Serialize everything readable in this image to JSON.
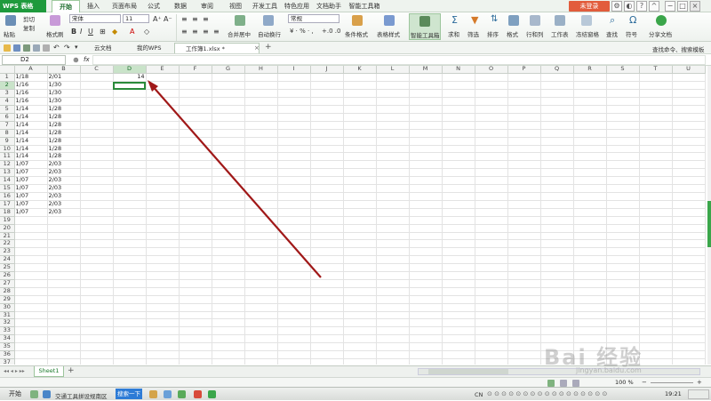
{
  "app": {
    "logo_label": "WPS 表格",
    "login_label": "未登录"
  },
  "menu": {
    "tabs": [
      {
        "label": "开始",
        "active": true
      },
      {
        "label": "插入"
      },
      {
        "label": "页面布局"
      },
      {
        "label": "公式"
      },
      {
        "label": "数据"
      },
      {
        "label": "审阅"
      },
      {
        "label": "视图"
      },
      {
        "label": "开发工具"
      },
      {
        "label": "特色应用"
      },
      {
        "label": "文档助手"
      },
      {
        "label": "智能工具箱"
      }
    ]
  },
  "ribbon": {
    "paste": "粘贴",
    "cut": "剪切",
    "copy": "复制",
    "format_painter": "格式刷",
    "font_name": "宋体",
    "font_size": "11",
    "merge_center": "合并居中",
    "wrap_text": "自动换行",
    "number_format": "常规",
    "conditional_format": "条件格式",
    "table_style": "表格样式",
    "smart_toolbox": "智能工具箱",
    "sum": "求和",
    "filter": "筛选",
    "sort": "排序",
    "format": "格式",
    "rows_cols": "行和列",
    "worksheet": "工作表",
    "freeze_panes": "冻结窗格",
    "find": "查找",
    "symbol": "符号",
    "share_doc": "分享文档"
  },
  "docs": {
    "tabs": [
      {
        "label": "云文档"
      },
      {
        "label": "我的WPS"
      },
      {
        "label": "工作簿1.xlsx *",
        "active": true
      }
    ],
    "search_label": "查找命令、搜索模板"
  },
  "formula": {
    "cell_ref": "D2",
    "fx": "fx",
    "value": ""
  },
  "grid": {
    "columns": [
      "A",
      "B",
      "C",
      "D",
      "E",
      "F",
      "G",
      "H",
      "I",
      "J",
      "K",
      "L",
      "M",
      "N",
      "O",
      "P",
      "Q",
      "R",
      "S",
      "T",
      "U"
    ],
    "selected_col": "D",
    "row_count": 38,
    "cells": {
      "A": [
        "1/18",
        "1/16",
        "1/16",
        "1/16",
        "1/14",
        "1/14",
        "1/14",
        "1/14",
        "1/14",
        "1/14",
        "1/14",
        "1/07",
        "1/07",
        "1/07",
        "1/07",
        "1/07",
        "1/07",
        "1/07"
      ],
      "B": [
        "2/01",
        "1/30",
        "1/30",
        "1/30",
        "1/28",
        "1/28",
        "1/28",
        "1/28",
        "1/28",
        "1/28",
        "1/28",
        "2/03",
        "2/03",
        "2/03",
        "2/03",
        "2/03",
        "2/03",
        "2/03"
      ],
      "D1": "14"
    }
  },
  "sheets": {
    "tabs": [
      {
        "label": "Sheet1",
        "active": true
      }
    ]
  },
  "status": {
    "zoom": "100 %"
  },
  "taskbar": {
    "start_label": "开始",
    "window_label": "交通工具拼设规南区",
    "search_label": "搜索一下",
    "ime_label": "CN",
    "clock": "19:21"
  },
  "watermark": {
    "text": "Bai 经验",
    "sub": "jingyan.baidu.com"
  },
  "colors": {
    "accent": "#1e9a3c",
    "arrow": "#a01818"
  }
}
